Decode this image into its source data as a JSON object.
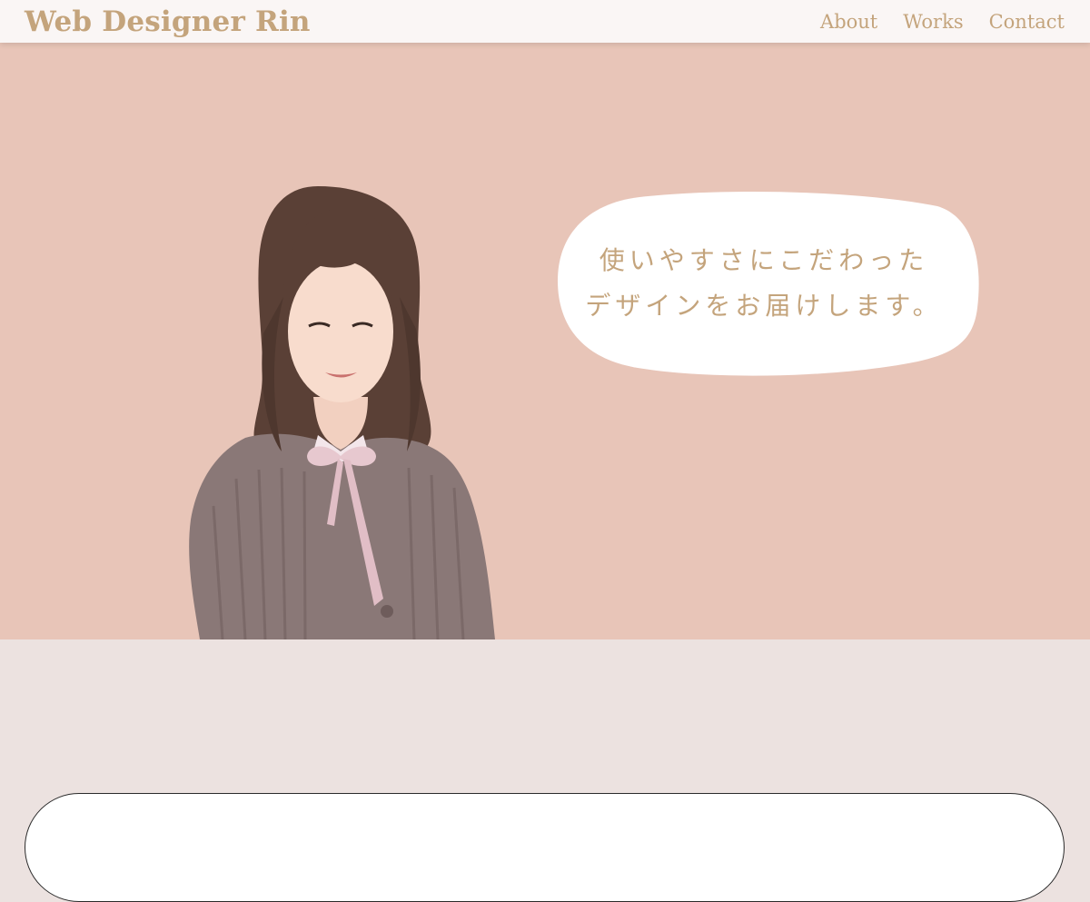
{
  "header": {
    "site_title": "Web Designer Rin",
    "nav": [
      {
        "label": "About"
      },
      {
        "label": "Works"
      },
      {
        "label": "Contact"
      }
    ]
  },
  "hero": {
    "speech_lines": [
      "使いやすさにこだわった",
      "デザインをお届けします。"
    ]
  },
  "colors": {
    "accent": "#c4a47c",
    "hero_background": "#e8c5b8",
    "page_background": "#ece2e0",
    "header_background": "#faf6f5"
  }
}
